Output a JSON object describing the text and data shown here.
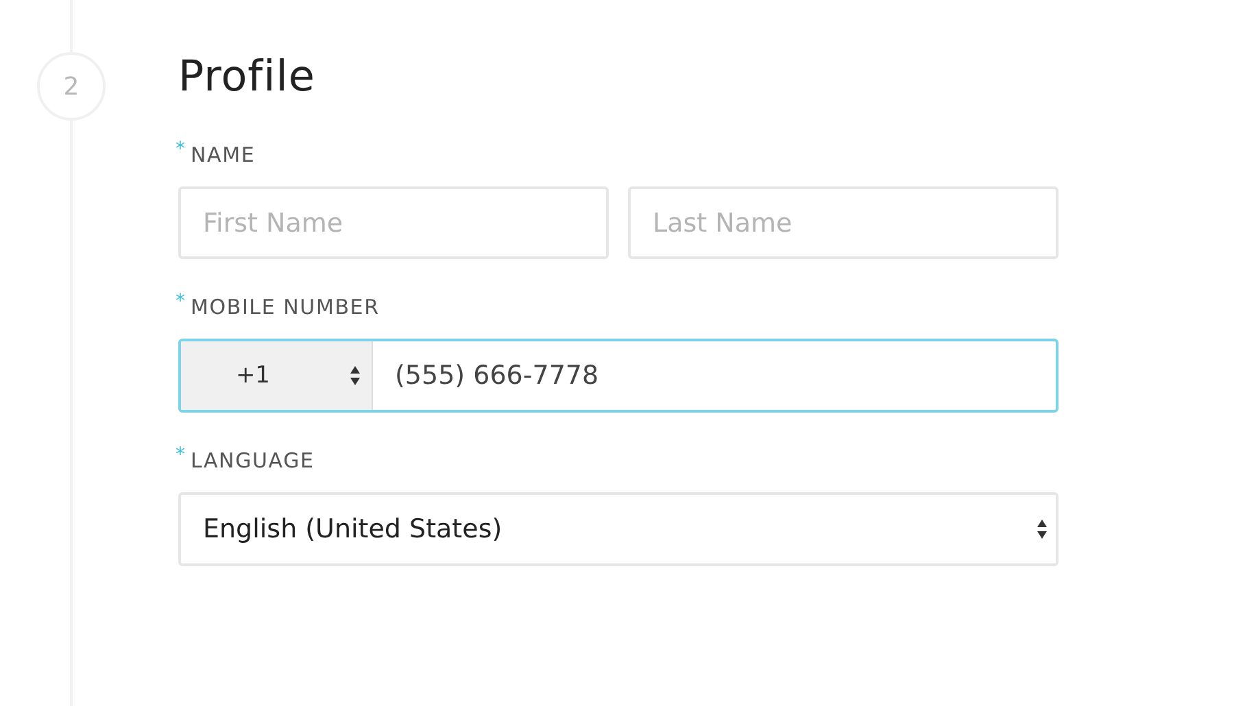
{
  "step": {
    "number": "2"
  },
  "heading": "Profile",
  "fields": [
    {
      "kind": "pair",
      "label": "NAME",
      "required_mark": "*",
      "placeholders": [
        "First Name",
        "Last Name"
      ]
    },
    {
      "kind": "phone",
      "label": "MOBILE NUMBER",
      "required_mark": "*",
      "code": "+1",
      "value": "(555) 666-7778",
      "focused": true
    },
    {
      "kind": "select",
      "label": "LANGUAGE",
      "required_mark": "*",
      "value": "English (United States)",
      "focused": false
    }
  ]
}
